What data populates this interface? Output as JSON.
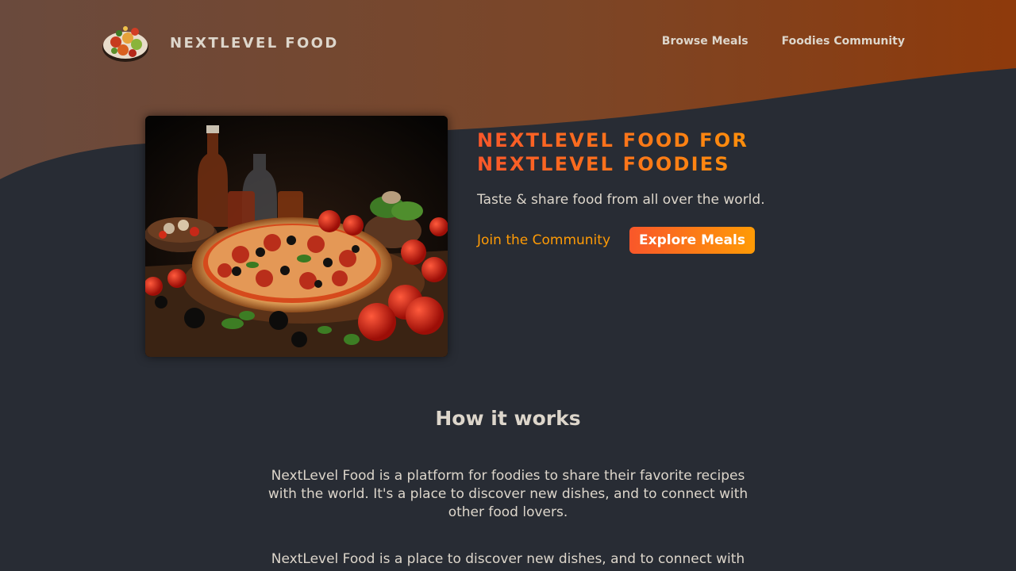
{
  "colors": {
    "background": "#282c34",
    "header_wave_start": "#6a4a3d",
    "header_wave_end": "#8c3a0c",
    "accent_start": "#f9572a",
    "accent_end": "#ff9b05",
    "text": "#ddd6cb"
  },
  "header": {
    "logo_icon": "food-platter-icon",
    "brand": "NEXTLEVEL FOOD",
    "nav": [
      {
        "label": "Browse Meals"
      },
      {
        "label": "Foodies Community"
      }
    ]
  },
  "hero": {
    "image_icon": "pizza-photo",
    "title_line1": "NEXTLEVEL FOOD FOR",
    "title_line2": "NEXTLEVEL FOODIES",
    "tagline": "Taste & share food from all over the world.",
    "join_link": "Join the Community",
    "explore_button": "Explore Meals"
  },
  "how_it_works": {
    "heading": "How it works",
    "paragraph1": "NextLevel Food is a platform for foodies to share their favorite recipes with the world. It's a place to discover new dishes, and to connect with other food lovers.",
    "paragraph2": "NextLevel Food is a place to discover new dishes, and to connect with other food lovers."
  }
}
